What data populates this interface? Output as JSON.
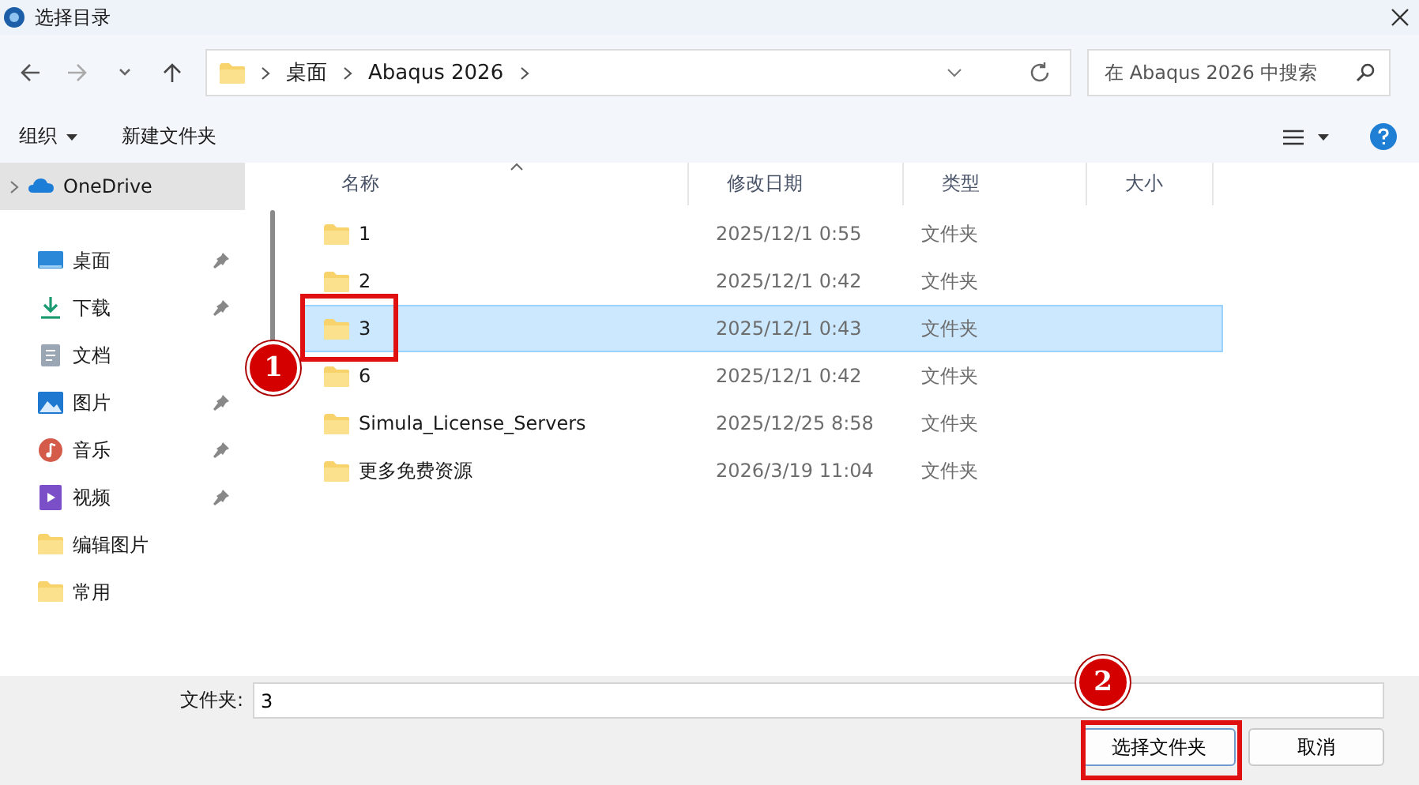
{
  "window": {
    "title": "选择目录"
  },
  "navigation": {
    "breadcrumb": [
      "桌面",
      "Abaqus 2026"
    ],
    "search": {
      "placeholder": "在 Abaqus 2026 中搜索"
    }
  },
  "toolbar": {
    "organize": "组织",
    "new_folder": "新建文件夹"
  },
  "sidebar": {
    "items": [
      {
        "label": "OneDrive",
        "kind": "cloud",
        "selected": true,
        "pinned": false
      },
      {
        "label": "桌面",
        "kind": "desktop",
        "selected": false,
        "pinned": true
      },
      {
        "label": "下载",
        "kind": "download",
        "selected": false,
        "pinned": true
      },
      {
        "label": "文档",
        "kind": "documents",
        "selected": false,
        "pinned": false
      },
      {
        "label": "图片",
        "kind": "pictures",
        "selected": false,
        "pinned": true
      },
      {
        "label": "音乐",
        "kind": "music",
        "selected": false,
        "pinned": true
      },
      {
        "label": "视频",
        "kind": "videos",
        "selected": false,
        "pinned": true
      },
      {
        "label": "编辑图片",
        "kind": "folder",
        "selected": false,
        "pinned": false
      },
      {
        "label": "常用",
        "kind": "folder",
        "selected": false,
        "pinned": false
      }
    ]
  },
  "file_list": {
    "columns": [
      "名称",
      "修改日期",
      "类型",
      "大小"
    ],
    "rows": [
      {
        "name": "1",
        "modified": "2025/12/1 0:55",
        "type": "文件夹",
        "selected": false
      },
      {
        "name": "2",
        "modified": "2025/12/1 0:42",
        "type": "文件夹",
        "selected": false
      },
      {
        "name": "3",
        "modified": "2025/12/1 0:43",
        "type": "文件夹",
        "selected": true
      },
      {
        "name": "6",
        "modified": "2025/12/1 0:42",
        "type": "文件夹",
        "selected": false
      },
      {
        "name": "Simula_License_Servers",
        "modified": "2025/12/25 8:58",
        "type": "文件夹",
        "selected": false
      },
      {
        "name": "更多免费资源",
        "modified": "2026/3/19 11:04",
        "type": "文件夹",
        "selected": false
      }
    ]
  },
  "footer": {
    "folder_label": "文件夹:",
    "folder_value": "3",
    "buttons": [
      {
        "label": "选择文件夹",
        "kind": "primary"
      },
      {
        "label": "取消",
        "kind": "secondary"
      }
    ]
  },
  "annotations": [
    {
      "label": "1"
    },
    {
      "label": "2"
    }
  ]
}
